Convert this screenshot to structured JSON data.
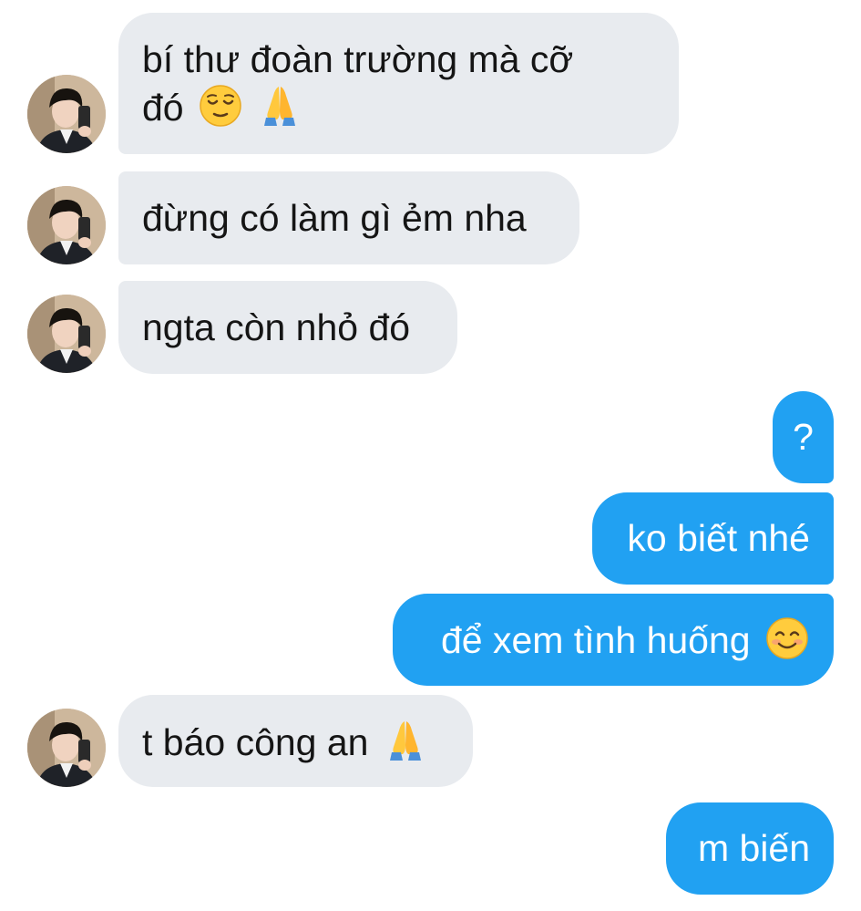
{
  "messages": [
    {
      "side": "incoming",
      "text": "bí thư đoàn trường mà cỡ",
      "text_line2": "đó",
      "emojis": [
        "relieved-face",
        "folded-hands"
      ]
    },
    {
      "side": "incoming",
      "text": "đừng có làm gì ẻm nha"
    },
    {
      "side": "incoming",
      "text": "ngta còn nhỏ đó"
    },
    {
      "side": "outgoing",
      "text": "?"
    },
    {
      "side": "outgoing",
      "text": "ko biết nhé"
    },
    {
      "side": "outgoing",
      "text": "để xem tình huống",
      "emojis": [
        "smiling-face-with-smiling-eyes"
      ]
    },
    {
      "side": "incoming",
      "text": "t báo công an",
      "emojis": [
        "folded-hands"
      ]
    },
    {
      "side": "outgoing",
      "text": "m biến"
    }
  ],
  "colors": {
    "incoming_bubble": "#e8ebef",
    "incoming_text": "#151515",
    "outgoing_bubble": "#21a1f2",
    "outgoing_text": "#ffffff"
  }
}
